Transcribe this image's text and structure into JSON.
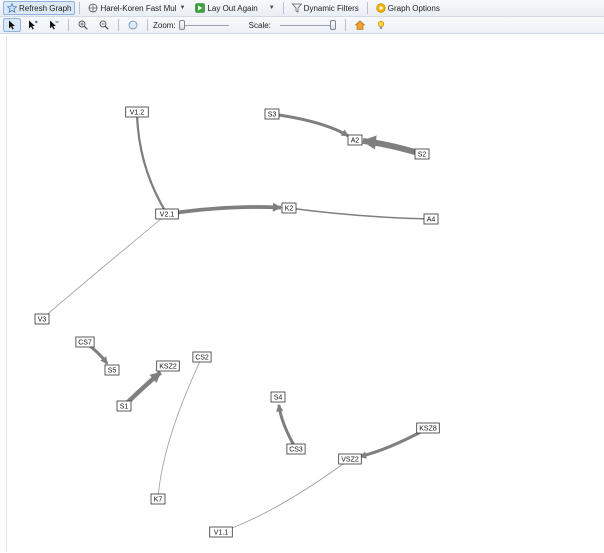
{
  "toolbar": {
    "refresh_label": "Refresh Graph",
    "layout_label": "Harel-Koren Fast Mul",
    "layout_again_label": "Lay Out Again",
    "dynamic_filters_label": "Dynamic Filters",
    "graph_options_label": "Graph Options",
    "zoom_label": "Zoom:",
    "scale_label": "Scale:",
    "zoom_value": 0.0,
    "scale_value": 1.0
  },
  "graph": {
    "nodes": [
      {
        "id": "V1.2",
        "label": "V1.2"
      },
      {
        "id": "S3",
        "label": "S3"
      },
      {
        "id": "A2",
        "label": "A2"
      },
      {
        "id": "S2",
        "label": "S2"
      },
      {
        "id": "V2.1",
        "label": "V2.1"
      },
      {
        "id": "K2",
        "label": "K2"
      },
      {
        "id": "A4",
        "label": "A4"
      },
      {
        "id": "V3",
        "label": "V3"
      },
      {
        "id": "CS7",
        "label": "CS7"
      },
      {
        "id": "S5",
        "label": "S5"
      },
      {
        "id": "KSZ2",
        "label": "KSZ2"
      },
      {
        "id": "CS2",
        "label": "CS2"
      },
      {
        "id": "S1",
        "label": "S1"
      },
      {
        "id": "S4",
        "label": "S4"
      },
      {
        "id": "CS3",
        "label": "CS3"
      },
      {
        "id": "KSZ8",
        "label": "KSZ8"
      },
      {
        "id": "VSZ2",
        "label": "VSZ2"
      },
      {
        "id": "K7",
        "label": "K7"
      },
      {
        "id": "V1.1",
        "label": "V1.1"
      }
    ],
    "edges": [
      {
        "from": "V1.2",
        "to": "V2.1",
        "weight": 3,
        "arrow": false
      },
      {
        "from": "S3",
        "to": "A2",
        "weight": 4,
        "arrow": true
      },
      {
        "from": "S2",
        "to": "A2",
        "weight": 8,
        "arrow": true
      },
      {
        "from": "V2.1",
        "to": "K2",
        "weight": 5,
        "arrow": true
      },
      {
        "from": "K2",
        "to": "A4",
        "weight": 2,
        "arrow": false
      },
      {
        "from": "V2.1",
        "to": "V3",
        "weight": 1,
        "arrow": false
      },
      {
        "from": "CS7",
        "to": "S5",
        "weight": 4,
        "arrow": true
      },
      {
        "from": "S1",
        "to": "KSZ2",
        "weight": 6,
        "arrow": true
      },
      {
        "from": "CS2",
        "to": "K7",
        "weight": 1,
        "arrow": false
      },
      {
        "from": "CS3",
        "to": "S4",
        "weight": 4,
        "arrow": true
      },
      {
        "from": "KSZ8",
        "to": "VSZ2",
        "weight": 4,
        "arrow": true
      },
      {
        "from": "VSZ2",
        "to": "V1.1",
        "weight": 1,
        "arrow": false
      }
    ]
  },
  "colors": {
    "edge": "#7f7f7f",
    "thin_edge": "#9a9a9a",
    "node_border": "#333333",
    "accent": "#8fb3dc"
  }
}
